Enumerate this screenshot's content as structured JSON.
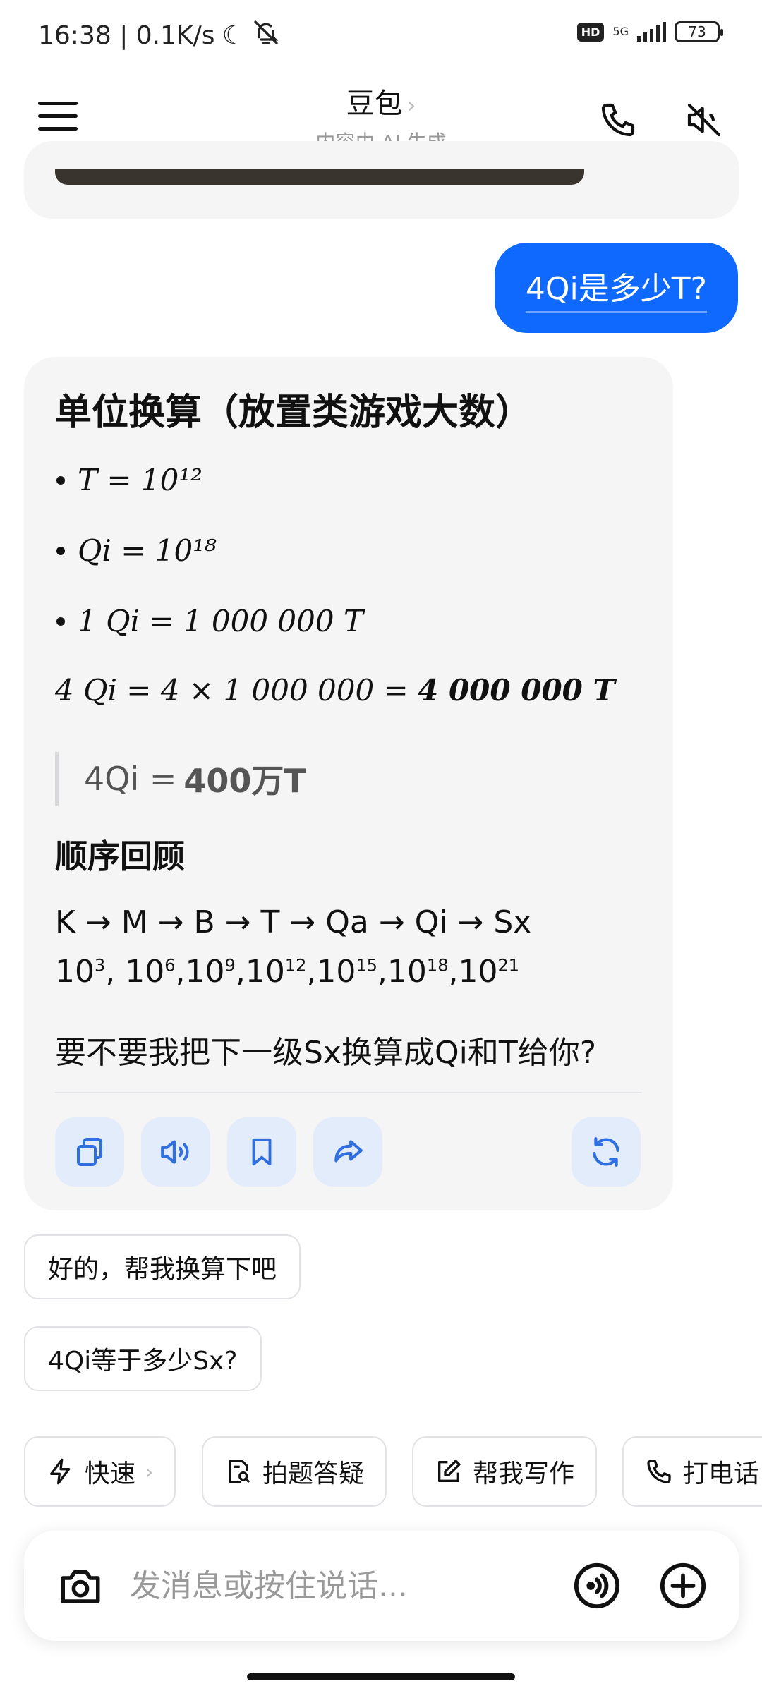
{
  "status_bar": {
    "time_speed": "16:38 | 0.1K/s",
    "moon": "☾",
    "hd": "HD",
    "network": "5G",
    "battery": "73"
  },
  "header": {
    "title": "豆包",
    "title_chevron": "›",
    "subtitle": "内容由 AI 生成"
  },
  "chat": {
    "user_message": "4Qi是多少T?",
    "ai_heading": "单位换算（放置类游戏大数）",
    "bullets": [
      "T = 10¹²",
      "Qi = 10¹⁸",
      "1 Qi = 1 000 000 T"
    ],
    "equation_prefix": "4 Qi = 4 × 1 000 000 = ",
    "equation_result": "4 000 000 T",
    "quote_prefix": "4Qi =",
    "quote_bold": "400万T",
    "sub_heading": "顺序回顾",
    "sequence": "K → M → B → T → Qa → Qi → Sx",
    "powers": [
      {
        "base": "10",
        "exp": "3",
        "sep": ", "
      },
      {
        "base": "10",
        "exp": "6",
        "sep": ","
      },
      {
        "base": "10",
        "exp": "9",
        "sep": ","
      },
      {
        "base": "10",
        "exp": "12",
        "sep": ","
      },
      {
        "base": "10",
        "exp": "15",
        "sep": ","
      },
      {
        "base": "10",
        "exp": "18",
        "sep": ","
      },
      {
        "base": "10",
        "exp": "21",
        "sep": ""
      }
    ],
    "followup": "要不要我把下一级Sx换算成Qi和T给你?"
  },
  "suggestions": [
    "好的，帮我换算下吧",
    "4Qi等于多少Sx?"
  ],
  "tools": [
    {
      "label": "快速",
      "chevron": "›"
    },
    {
      "label": "拍题答疑"
    },
    {
      "label": "帮我写作"
    },
    {
      "label": "打电话"
    }
  ],
  "input": {
    "placeholder": "发消息或按住说话..."
  },
  "colors": {
    "accent": "#0f69ff",
    "action_bg": "#e3ecfb",
    "action_icon": "#2f6fe0",
    "card_bg": "#f5f5f6"
  }
}
